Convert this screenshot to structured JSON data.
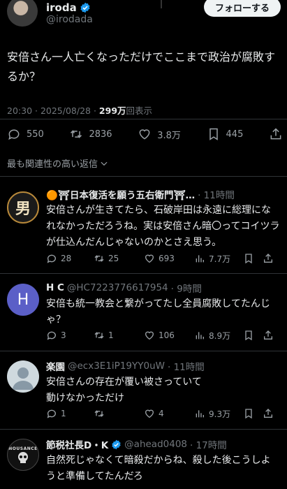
{
  "author": {
    "name": "iroda",
    "handle": "@irodada",
    "follow_label": "フォローする"
  },
  "post": {
    "text": "安倍さん一人亡くなっただけでここまで政治が腐敗するか？",
    "time": "20:30 · 2025/08/28 · ",
    "views": "299万",
    "views_suffix": "回表示"
  },
  "actions": {
    "replies": "550",
    "reposts": "2836",
    "likes": "3.8万",
    "bookmarks": "445"
  },
  "sort_label": "最も関連性の高い返信",
  "replies": [
    {
      "name": "🟠⛩日本復活を願う五右衛門⛩…",
      "handle": "",
      "time": "· 11時間",
      "text": "安倍さんが生きてたら、石破岸田は永遠に総理になれなかっただろうね。実は安倍さん暗〇ってコイツラが仕込んだんじゃないのかとさえ思う。",
      "avatar_text": "男",
      "stats": {
        "replies": "28",
        "reposts": "25",
        "likes": "693",
        "views": "7.7万"
      }
    },
    {
      "name": "H C",
      "handle": "@HC7223776617954",
      "time": "· 9時間",
      "text": "安倍も統一教会と繋がってたし全員腐敗してたんじゃ？",
      "avatar_text": "H",
      "stats": {
        "replies": "3",
        "reposts": "1",
        "likes": "106",
        "views": "8.9万"
      }
    },
    {
      "name": "楽園",
      "handle": "@ecx3E1iP19YY0uW",
      "time": "· 11時間",
      "text": "安倍さんの存在が覆い被さっていて\n動けなかっただけ",
      "avatar_text": "",
      "stats": {
        "replies": "1",
        "reposts": "",
        "likes": "4",
        "views": "9.3万"
      }
    },
    {
      "name": "節税社長D・K",
      "handle": "@ahead0408",
      "time": "· 17時間",
      "text": "自然死じゃなくて暗殺だからね、殺した後こうしようと準備してたんだろ",
      "avatar_text": "NOUSANCE",
      "stats": {
        "replies": "",
        "reposts": "",
        "likes": "",
        "views": ""
      }
    }
  ],
  "colors": {
    "accent": "#1d9bf0",
    "orange": "#f28c28",
    "torii": "#e0245e"
  }
}
